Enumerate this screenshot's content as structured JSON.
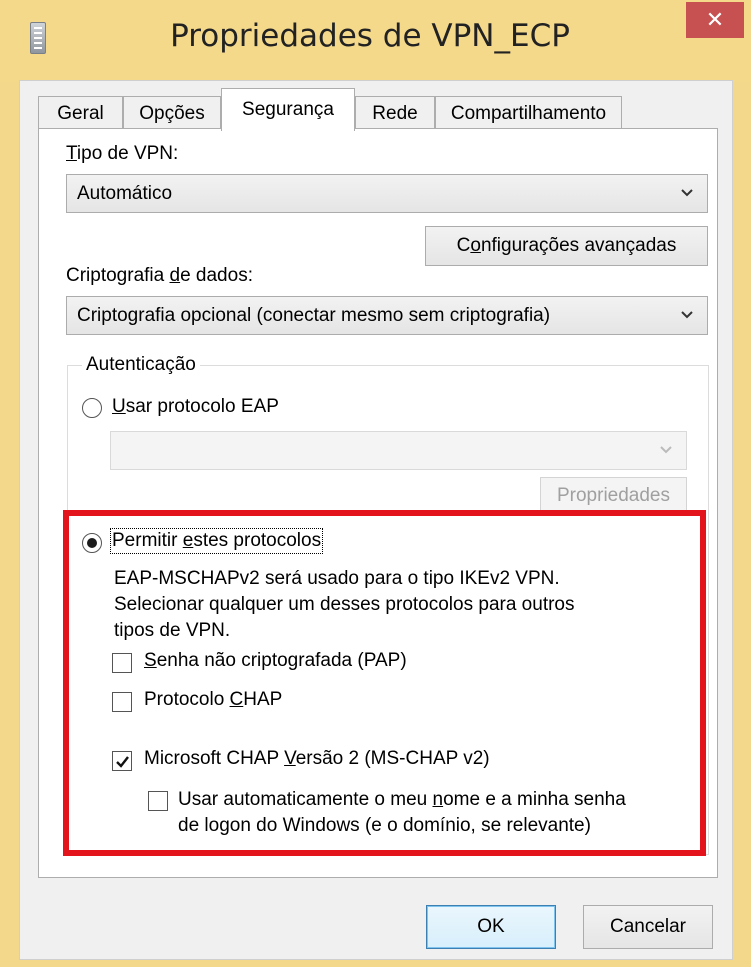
{
  "window": {
    "title": "Propriedades de VPN_ECP",
    "close_label": "✕"
  },
  "tabs": [
    {
      "label": "Geral",
      "active": false
    },
    {
      "label": "Opções",
      "active": false
    },
    {
      "label": "Segurança",
      "active": true
    },
    {
      "label": "Rede",
      "active": false
    },
    {
      "label": "Compartilhamento",
      "active": false
    }
  ],
  "security": {
    "vpn_type_label_u": "T",
    "vpn_type_label_rest": "ipo de VPN:",
    "vpn_type_value": "Automático",
    "advanced_button_u": "o",
    "advanced_button_pre": "C",
    "advanced_button_post": "nfigurações avançadas",
    "encryption_label_pre": "Criptografia ",
    "encryption_label_u": "d",
    "encryption_label_post": "e dados:",
    "encryption_value": "Criptografia opcional (conectar mesmo sem criptografia)"
  },
  "auth": {
    "legend": "Autenticação",
    "eap_option_u": "U",
    "eap_option_rest": "sar protocolo EAP",
    "eap_select_value": "",
    "eap_properties_button": "Propriedades",
    "allow_option_pre": "Permitir ",
    "allow_option_u": "e",
    "allow_option_post": "stes protocolos",
    "note_line1": "EAP-MSCHAPv2 será usado para o tipo IKEv2 VPN.",
    "note_line2": "Selecionar qualquer um desses protocolos para outros",
    "note_line3": "tipos de VPN.",
    "pap_u": "S",
    "pap_rest": "enha não criptografada (PAP)",
    "chap_pre": "Protocolo ",
    "chap_u": "C",
    "chap_post": "HAP",
    "mschap_pre": "Microsoft CHAP ",
    "mschap_u": "V",
    "mschap_post": "ersão 2 (MS-CHAP v2)",
    "auto_line1_pre": "Usar automaticamente o meu ",
    "auto_line1_u": "n",
    "auto_line1_post": "ome e a minha senha",
    "auto_line2": "de logon do Windows (e o domínio, se relevante)",
    "eap_selected": false,
    "allow_selected": true,
    "pap_checked": false,
    "chap_checked": false,
    "mschap_checked": true,
    "auto_checked": false
  },
  "footer": {
    "ok_label": "OK",
    "cancel_label": "Cancelar"
  },
  "colors": {
    "titlebar": "#f4d98b",
    "close": "#c75050",
    "highlight": "#e3141c"
  }
}
